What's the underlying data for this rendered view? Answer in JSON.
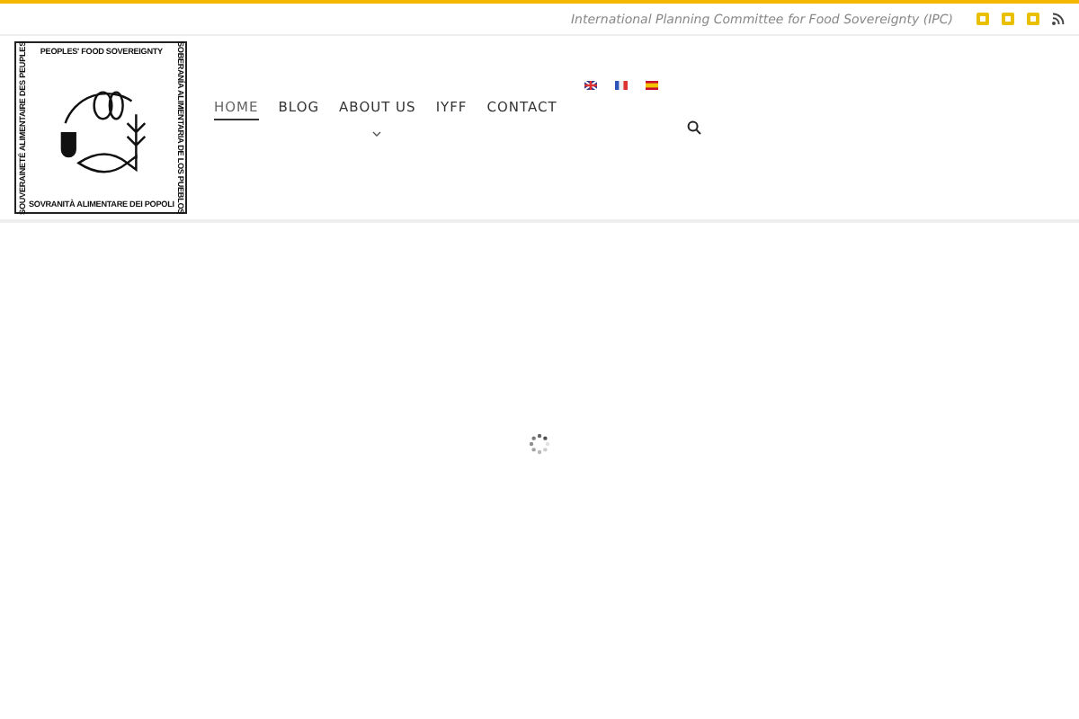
{
  "topbar": {
    "tagline": "International Planning Committee for Food Sovereignty (IPC)"
  },
  "logo": {
    "top": "PEOPLES' FOOD SOVEREIGNTY",
    "left": "SOUVERAINETÉ ALIMENTAIRE DES PEUPLES",
    "right": "SOBERANÍA ALIMENTARIA DE LOS PUEBLOS",
    "bottom": "SOVRANITÀ ALIMENTARE DEI POPOLI"
  },
  "nav": [
    {
      "label": "HOME",
      "selected": true,
      "dropdown": false
    },
    {
      "label": "BLOG",
      "selected": false,
      "dropdown": false
    },
    {
      "label": "ABOUT US",
      "selected": false,
      "dropdown": true
    },
    {
      "label": "IYFF",
      "selected": false,
      "dropdown": false
    },
    {
      "label": "CONTACT",
      "selected": false,
      "dropdown": false
    }
  ],
  "languages": [
    {
      "kind": "uk"
    },
    {
      "kind": "fr"
    },
    {
      "kind": "es"
    }
  ]
}
